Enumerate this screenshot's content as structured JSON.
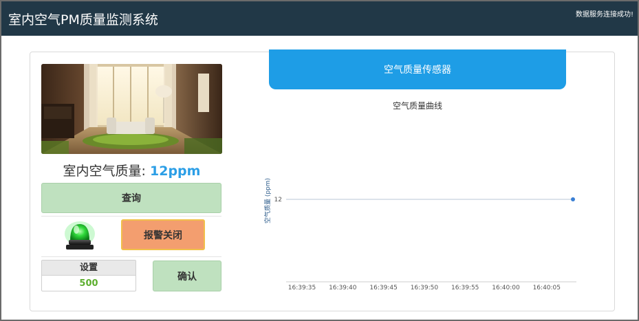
{
  "header": {
    "title": "室内空气PM质量监测系统",
    "status": "数据服务连接成功!"
  },
  "left": {
    "aq_label": "室内空气质量:",
    "aq_value": "12ppm",
    "query_button": "查询",
    "alarm_button": "报警关闭",
    "setting_label": "设置",
    "setting_value": "500",
    "confirm_button": "确认"
  },
  "sensor_panel": {
    "label": "空气质量传感器"
  },
  "chart_data": {
    "type": "line",
    "title": "空气质量曲线",
    "ylabel": "空气质量 (ppm)",
    "xlabel": "",
    "x": [
      "16:39:35",
      "16:39:40",
      "16:39:45",
      "16:39:50",
      "16:39:55",
      "16:40:00",
      "16:40:05"
    ],
    "yticks": [
      12
    ],
    "series": [
      {
        "points": [
          {
            "x": "16:40:08",
            "y": 12
          }
        ],
        "color": "#3a7fd4"
      }
    ],
    "reference_line": 12,
    "grid": false
  },
  "colors": {
    "header_bg": "#213847",
    "accent_blue": "#1e9de6",
    "value_blue": "#2b9ee6",
    "button_green": "#bfe1bf",
    "alarm_orange": "#f39e6f",
    "setting_green": "#5cae2e"
  },
  "icons": {
    "lamp": "green-alarm-lamp-icon"
  }
}
